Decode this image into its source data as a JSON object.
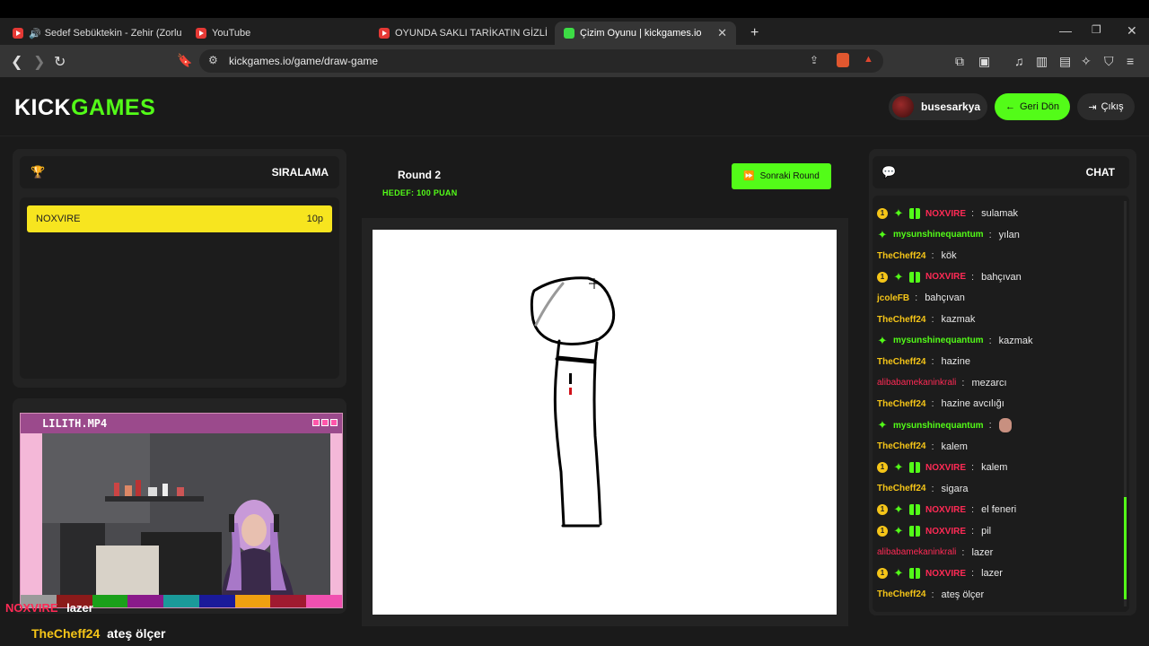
{
  "browser": {
    "tabs": [
      {
        "label": "Sedef Sebüktekin - Zehir (Zorlu P",
        "icon": "youtube-icon"
      },
      {
        "label": "YouTube",
        "icon": "youtube-icon"
      },
      {
        "label": "OYUNDA SAKLI TARİKATIN GİZLİ SIR",
        "icon": "youtube-icon"
      },
      {
        "label": "Çizim Oyunu | kickgames.io",
        "icon": "kickgames-icon"
      }
    ],
    "url": "kickgames.io/game/draw-game"
  },
  "header": {
    "logo_kick": "KICK",
    "logo_games": "GAMES",
    "username": "busesarkya",
    "back_label": "Geri Dön",
    "exit_label": "Çıkış"
  },
  "leaderboard": {
    "title": "SIRALAMA",
    "rows": [
      {
        "name": "NOXVIRE",
        "points": "10p"
      }
    ]
  },
  "game": {
    "round": "Round 2",
    "target": "HEDEF: 100 PUAN",
    "next_label": "Sonraki Round"
  },
  "webcam": {
    "title": "LILITH.MP4",
    "palette": [
      "#9a9a9a",
      "#8b1a1a",
      "#1aa01a",
      "#8a1a8a",
      "#1a9a9a",
      "#1a1a9a",
      "#f0a010",
      "#a01a30",
      "#f050b0"
    ]
  },
  "stream_chat": [
    {
      "user": "NOXVIRE",
      "text": "lazer"
    },
    {
      "user": "TheCheff24",
      "text": "ateş ölçer"
    }
  ],
  "chat": {
    "title": "CHAT",
    "messages": [
      {
        "user": "NOXVIRE",
        "text": "sulamak",
        "badges": true
      },
      {
        "user": "mysunshinequantum",
        "text": "yılan",
        "star": true
      },
      {
        "user": "TheCheff24",
        "text": "kök"
      },
      {
        "user": "NOXVIRE",
        "text": "bahçıvan",
        "badges": true
      },
      {
        "user": "jcoleFB",
        "text": "bahçıvan"
      },
      {
        "user": "TheCheff24",
        "text": "kazmak"
      },
      {
        "user": "mysunshinequantum",
        "text": "kazmak",
        "star": true
      },
      {
        "user": "TheCheff24",
        "text": "hazine"
      },
      {
        "user": "alibabamekaninkrali",
        "text": "mezarcı"
      },
      {
        "user": "TheCheff24",
        "text": "hazine avcılığı"
      },
      {
        "user": "mysunshinequantum",
        "text": "",
        "star": true,
        "emoji": true
      },
      {
        "user": "TheCheff24",
        "text": "kalem"
      },
      {
        "user": "NOXVIRE",
        "text": "kalem",
        "badges": true
      },
      {
        "user": "TheCheff24",
        "text": "sigara"
      },
      {
        "user": "NOXVIRE",
        "text": "el feneri",
        "badges": true
      },
      {
        "user": "NOXVIRE",
        "text": "pil",
        "badges": true
      },
      {
        "user": "alibabamekaninkrali",
        "text": "lazer"
      },
      {
        "user": "NOXVIRE",
        "text": "lazer",
        "badges": true
      },
      {
        "user": "TheCheff24",
        "text": "ateş ölçer"
      }
    ]
  }
}
